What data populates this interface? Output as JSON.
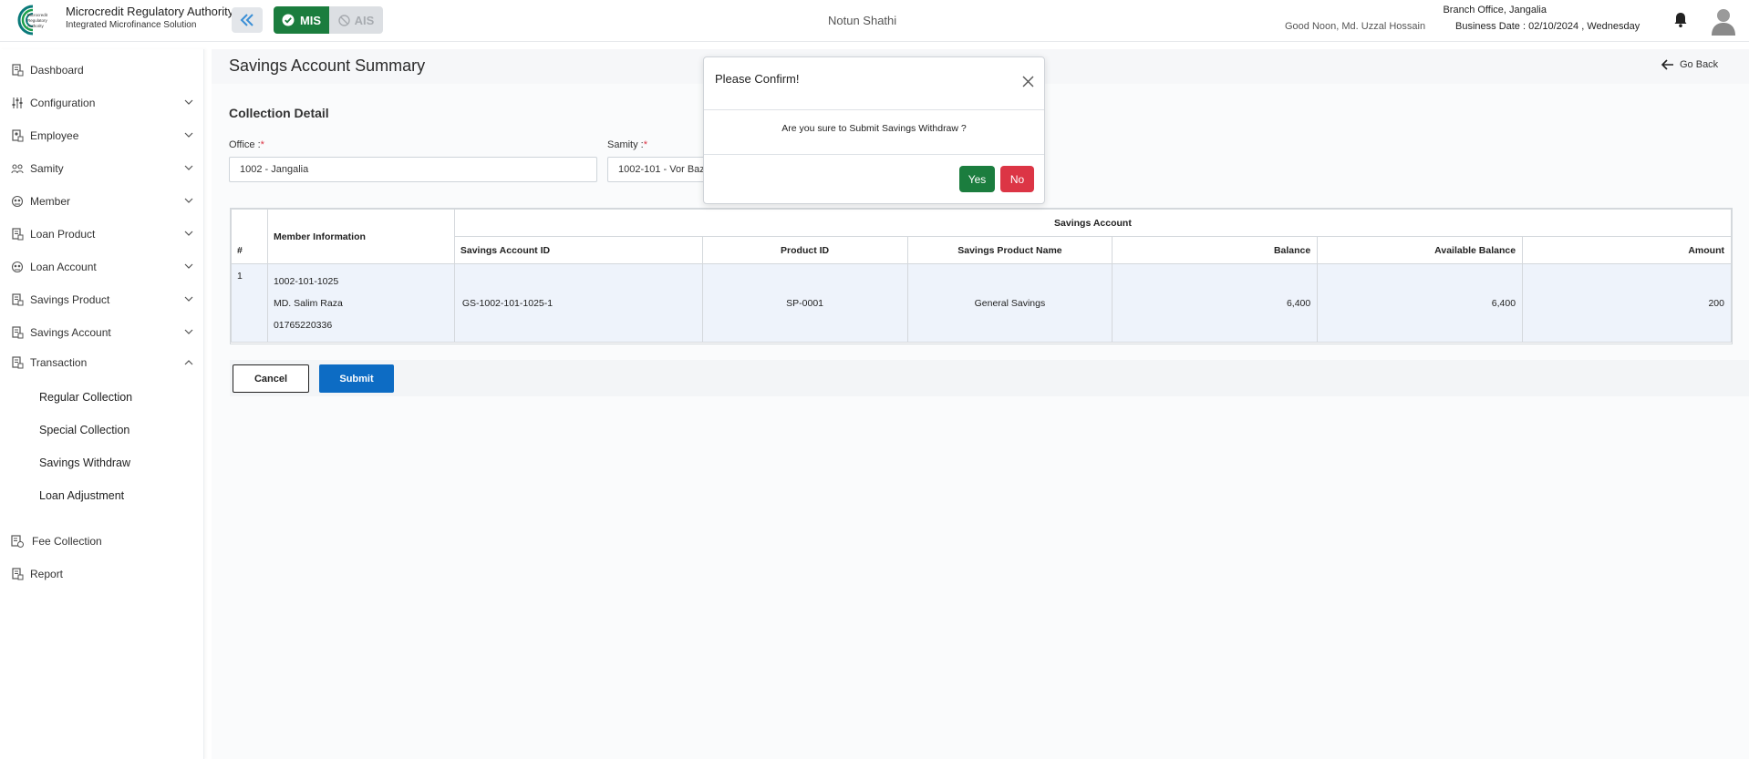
{
  "header": {
    "org_name": "Microcredit Regulatory Authority",
    "org_subtitle": "Integrated Microfinance Solution",
    "logo_text": "Microcredit Regulatory Authority",
    "mode_mis": "MIS",
    "mode_ais": "AIS",
    "app_name": "Notun Shathi",
    "greeting": "Good Noon, Md. Uzzal Hossain",
    "branch": "Branch Office, Jangalia",
    "business_date": "Business Date : 02/10/2024 , Wednesday"
  },
  "sidebar": {
    "items": [
      {
        "label": "Dashboard"
      },
      {
        "label": "Configuration"
      },
      {
        "label": "Employee"
      },
      {
        "label": "Samity"
      },
      {
        "label": "Member"
      },
      {
        "label": "Loan Product"
      },
      {
        "label": "Loan Account"
      },
      {
        "label": "Savings Product"
      },
      {
        "label": "Savings Account"
      },
      {
        "label": "Transaction"
      }
    ],
    "transaction_sub": [
      {
        "label": "Regular Collection"
      },
      {
        "label": "Special Collection"
      },
      {
        "label": "Savings Withdraw"
      },
      {
        "label": "Loan Adjustment"
      }
    ],
    "bottom_items": [
      {
        "label": "Fee Collection"
      },
      {
        "label": "Report"
      }
    ]
  },
  "main": {
    "page_title": "Savings Account Summary",
    "go_back": "Go Back",
    "section_title": "Collection Detail",
    "office_label": "Office :",
    "office_value": "1002 - Jangalia",
    "samity_label": "Samity :",
    "samity_value": "1002-101 - Vor Bazar",
    "required_mark": "*",
    "table": {
      "group_header": "Savings Account",
      "headers": {
        "index": "#",
        "member_info": "Member Information",
        "savings_account_id": "Savings Account ID",
        "product_id": "Product ID",
        "savings_product_name": "Savings Product Name",
        "balance": "Balance",
        "available_balance": "Available Balance",
        "amount": "Amount"
      },
      "rows": [
        {
          "index": "1",
          "member_id": "1002-101-1025",
          "member_name": "MD. Salim Raza",
          "member_phone": "01765220336",
          "savings_account_id": "GS-1002-101-1025-1",
          "product_id": "SP-0001",
          "savings_product_name": "General Savings",
          "balance": "6,400",
          "available_balance": "6,400",
          "amount": "200"
        }
      ]
    },
    "cancel_label": "Cancel",
    "submit_label": "Submit"
  },
  "modal": {
    "title": "Please Confirm!",
    "message": "Are you sure to Submit Savings Withdraw ?",
    "yes_label": "Yes",
    "no_label": "No"
  },
  "colors": {
    "mis_active": "#1b7d3e",
    "submit_blue": "#0d6cc4",
    "no_red": "#dc3545",
    "row_bg": "#eef3fb"
  }
}
